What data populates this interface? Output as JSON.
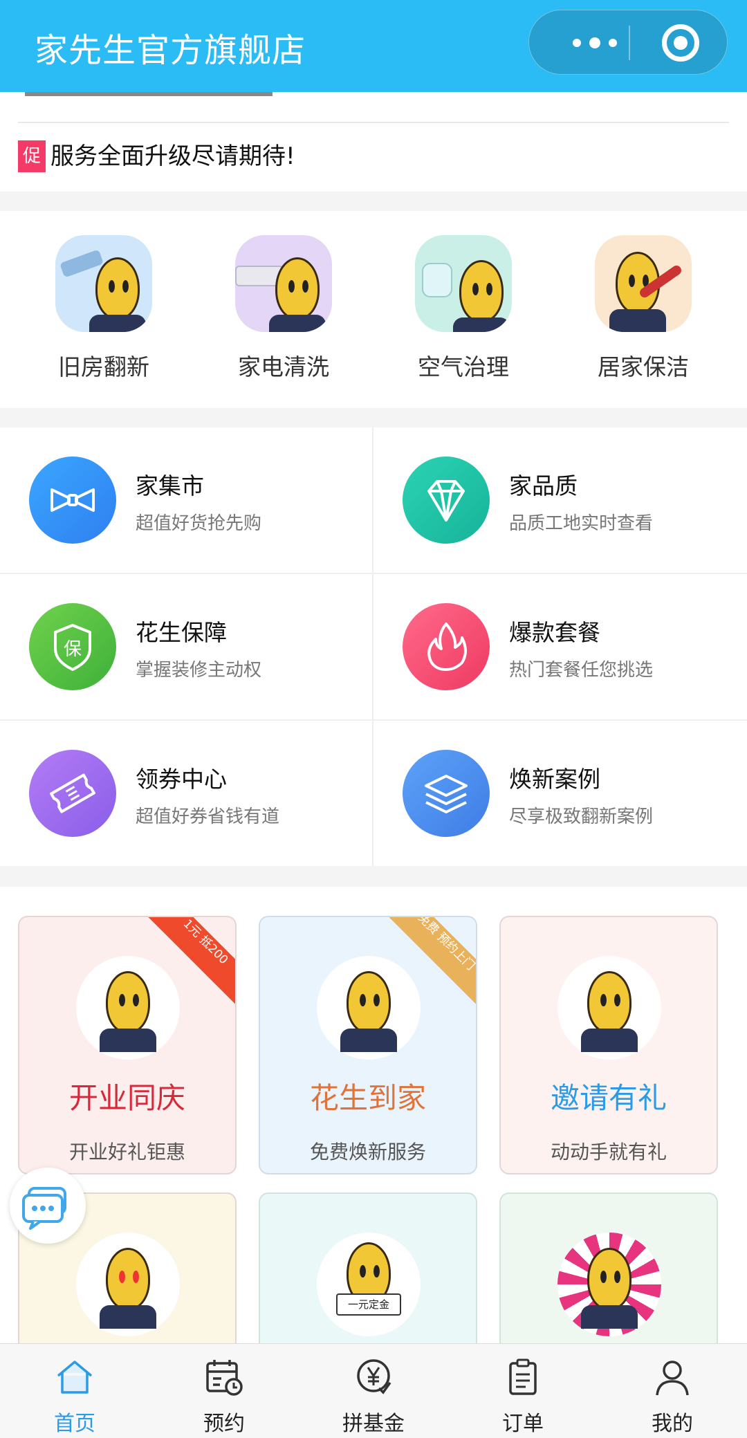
{
  "header": {
    "title": "家先生官方旗舰店"
  },
  "notice": {
    "tag": "促",
    "text": "服务全面升级尽请期待!"
  },
  "categories": [
    {
      "label": "旧房翻新",
      "icon": "roller-peanut-icon",
      "bg": "#cfe6fb"
    },
    {
      "label": "家电清洗",
      "icon": "aircon-peanut-icon",
      "bg": "#e3d6f6"
    },
    {
      "label": "空气治理",
      "icon": "sprayer-peanut-icon",
      "bg": "#c9efe7"
    },
    {
      "label": "居家保洁",
      "icon": "mop-peanut-icon",
      "bg": "#fbe7d0"
    }
  ],
  "services": [
    {
      "name": "家集市",
      "desc": "超值好货抢先购",
      "icon": "bowtie-icon",
      "color": "#2f8cf5"
    },
    {
      "name": "家品质",
      "desc": "品质工地实时查看",
      "icon": "diamond-icon",
      "color": "#1fc4a6"
    },
    {
      "name": "花生保障",
      "desc": "掌握装修主动权",
      "icon": "shield-icon",
      "color": "#55c245"
    },
    {
      "name": "爆款套餐",
      "desc": "热门套餐任您挑选",
      "icon": "flame-icon",
      "color": "#f4466b"
    },
    {
      "name": "领券中心",
      "desc": "超值好券省钱有道",
      "icon": "coupon-icon",
      "color": "#9a6cf0"
    },
    {
      "name": "焕新案例",
      "desc": "尽享极致翻新案例",
      "icon": "layers-icon",
      "color": "#4a8ff0"
    }
  ],
  "promos": [
    {
      "title": "开业同庆",
      "sub": "开业好礼钜惠",
      "title_color": "#d8293b",
      "bg": "#fdeeee",
      "ribbon": "1元 抵200",
      "ribbon_color": "#ef4a2c"
    },
    {
      "title": "花生到家",
      "sub": "免费焕新服务",
      "title_color": "#e0733a",
      "bg": "#e9f4fd",
      "ribbon": "免费 预约上门",
      "ribbon_color": "#e8b15a"
    },
    {
      "title": "邀请有礼",
      "sub": "动动手就有礼",
      "title_color": "#2b9be8",
      "bg": "#fdf2ef",
      "ribbon": "",
      "ribbon_color": ""
    }
  ],
  "promos_row2": [
    {
      "bg": "#fbf7e4",
      "sign": ""
    },
    {
      "bg": "#eaf8f7",
      "sign": "一元定金"
    },
    {
      "bg": "#eef8f0",
      "sign": ""
    }
  ],
  "tabs": [
    {
      "label": "首页",
      "icon": "home-icon",
      "active": true
    },
    {
      "label": "预约",
      "icon": "calendar-clock-icon"
    },
    {
      "label": "拼基金",
      "icon": "yen-badge-icon"
    },
    {
      "label": "订单",
      "icon": "clipboard-icon"
    },
    {
      "label": "我的",
      "icon": "user-icon"
    }
  ],
  "colors": {
    "header": "#2cbcf5",
    "active_tab": "#2b9be8"
  }
}
